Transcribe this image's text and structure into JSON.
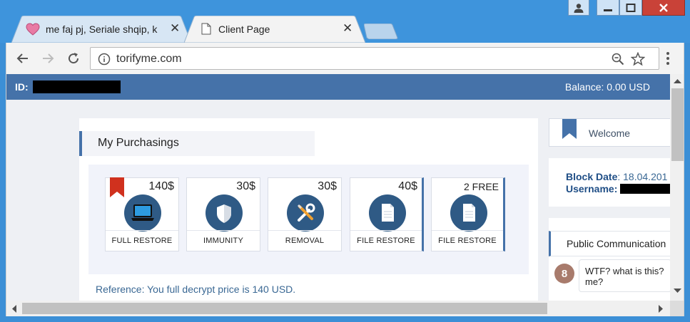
{
  "browser": {
    "tabs": [
      {
        "title": "me faj pj, Seriale shqip, k",
        "active": false
      },
      {
        "title": "Client Page",
        "active": true
      }
    ],
    "url": "torifyme.com"
  },
  "header": {
    "id_label": "ID:",
    "balance": "Balance: 0.00 USD"
  },
  "purchasing": {
    "title": "My Purchasings",
    "products": [
      {
        "name": "FULL RESTORE",
        "price": "140$",
        "icon": "laptop-icon"
      },
      {
        "name": "IMMUNITY",
        "price": "30$",
        "icon": "shield-icon"
      },
      {
        "name": "REMOVAL",
        "price": "30$",
        "icon": "tools-icon"
      },
      {
        "name": "FILE RESTORE",
        "price": "40$",
        "icon": "file-icon"
      },
      {
        "name": "FILE RESTORE",
        "price": "2 FREE",
        "icon": "file-icon"
      }
    ],
    "reference": "Reference: You full decrypt price is 140 USD."
  },
  "sidebar": {
    "welcome": "Welcome",
    "block_date_label": "Block Date",
    "block_date_value": ": 18.04.201",
    "username_label": "Username",
    "username_sep": ":",
    "public_comm": "Public Communication",
    "message": {
      "avatar": "8",
      "text": "WTF? what is this? me?"
    }
  },
  "colors": {
    "header_blue": "#4572a9",
    "icon_circle": "#2f5a85",
    "ribbon_red": "#d0311e",
    "titlebar_blue": "#3e94dc"
  }
}
